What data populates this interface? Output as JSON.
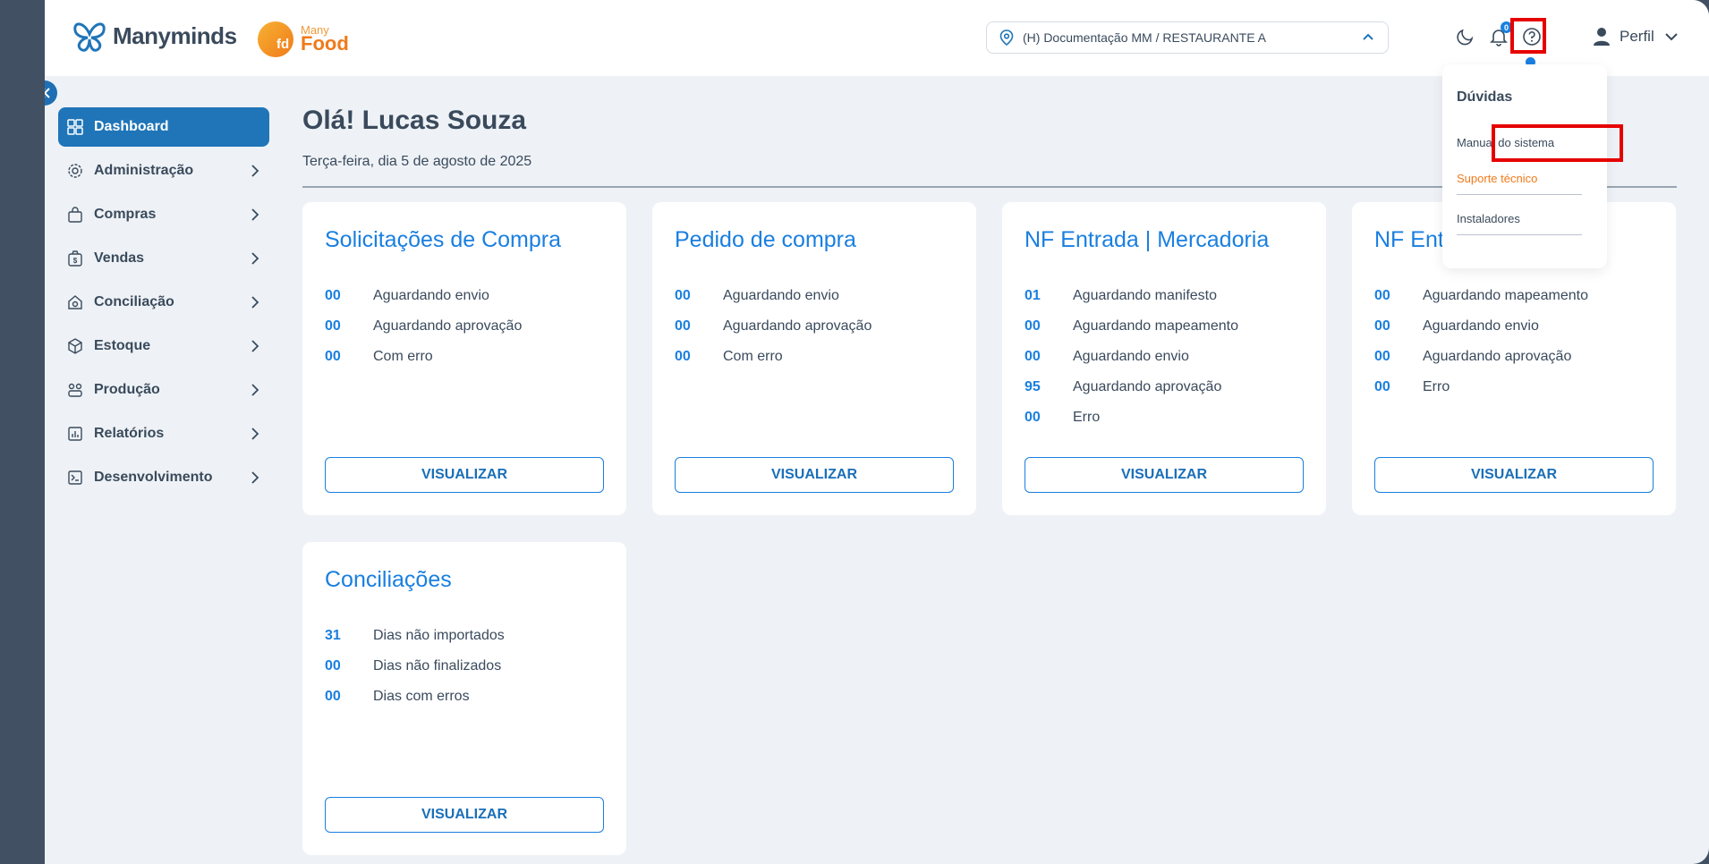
{
  "header": {
    "brand": "Manyminds",
    "food_logo": {
      "small": "Many",
      "big": "Food",
      "mark": "fd"
    },
    "location": "(H) Documentação MM / RESTAURANTE A",
    "notification_count": "0",
    "profile_label": "Perfil"
  },
  "sidebar": {
    "items": [
      {
        "label": "Dashboard",
        "icon": "dashboard-icon"
      },
      {
        "label": "Administração",
        "icon": "gear-icon"
      },
      {
        "label": "Compras",
        "icon": "bag-icon"
      },
      {
        "label": "Vendas",
        "icon": "money-icon"
      },
      {
        "label": "Conciliação",
        "icon": "reconcile-icon"
      },
      {
        "label": "Estoque",
        "icon": "box-icon"
      },
      {
        "label": "Produção",
        "icon": "production-icon"
      },
      {
        "label": "Relatórios",
        "icon": "report-icon"
      },
      {
        "label": "Desenvolvimento",
        "icon": "terminal-icon"
      }
    ]
  },
  "main": {
    "greeting": "Olá! Lucas Souza",
    "date": "Terça-feira, dia 5 de agosto de 2025",
    "button_label": "VISUALIZAR",
    "cards": [
      {
        "title": "Solicitações de Compra",
        "rows": [
          {
            "num": "00",
            "label": "Aguardando envio"
          },
          {
            "num": "00",
            "label": "Aguardando aprovação"
          },
          {
            "num": "00",
            "label": "Com erro"
          }
        ]
      },
      {
        "title": "Pedido de compra",
        "rows": [
          {
            "num": "00",
            "label": "Aguardando envio"
          },
          {
            "num": "00",
            "label": "Aguardando aprovação"
          },
          {
            "num": "00",
            "label": "Com erro"
          }
        ]
      },
      {
        "title": "NF Entrada | Mercadoria",
        "rows": [
          {
            "num": "01",
            "label": "Aguardando manifesto"
          },
          {
            "num": "00",
            "label": "Aguardando mapeamento"
          },
          {
            "num": "00",
            "label": "Aguardando envio"
          },
          {
            "num": "95",
            "label": "Aguardando aprovação"
          },
          {
            "num": "00",
            "label": "Erro"
          }
        ]
      },
      {
        "title": "NF Ent",
        "rows": [
          {
            "num": "00",
            "label": "Aguardando mapeamento"
          },
          {
            "num": "00",
            "label": "Aguardando envio"
          },
          {
            "num": "00",
            "label": "Aguardando aprovação"
          },
          {
            "num": "00",
            "label": "Erro"
          }
        ]
      },
      {
        "title": "Conciliações",
        "rows": [
          {
            "num": "31",
            "label": "Dias não importados"
          },
          {
            "num": "00",
            "label": "Dias não finalizados"
          },
          {
            "num": "00",
            "label": "Dias com erros"
          }
        ]
      }
    ]
  },
  "help_menu": {
    "title": "Dúvidas",
    "items": [
      "Manual do sistema",
      "Suporte técnico",
      "Instaladores"
    ]
  },
  "colors": {
    "accent": "#1a7fe0",
    "sidebar_active": "#1f75b8",
    "frame": "#415062",
    "highlight": "#e60000",
    "orange": "#f07a1a"
  }
}
